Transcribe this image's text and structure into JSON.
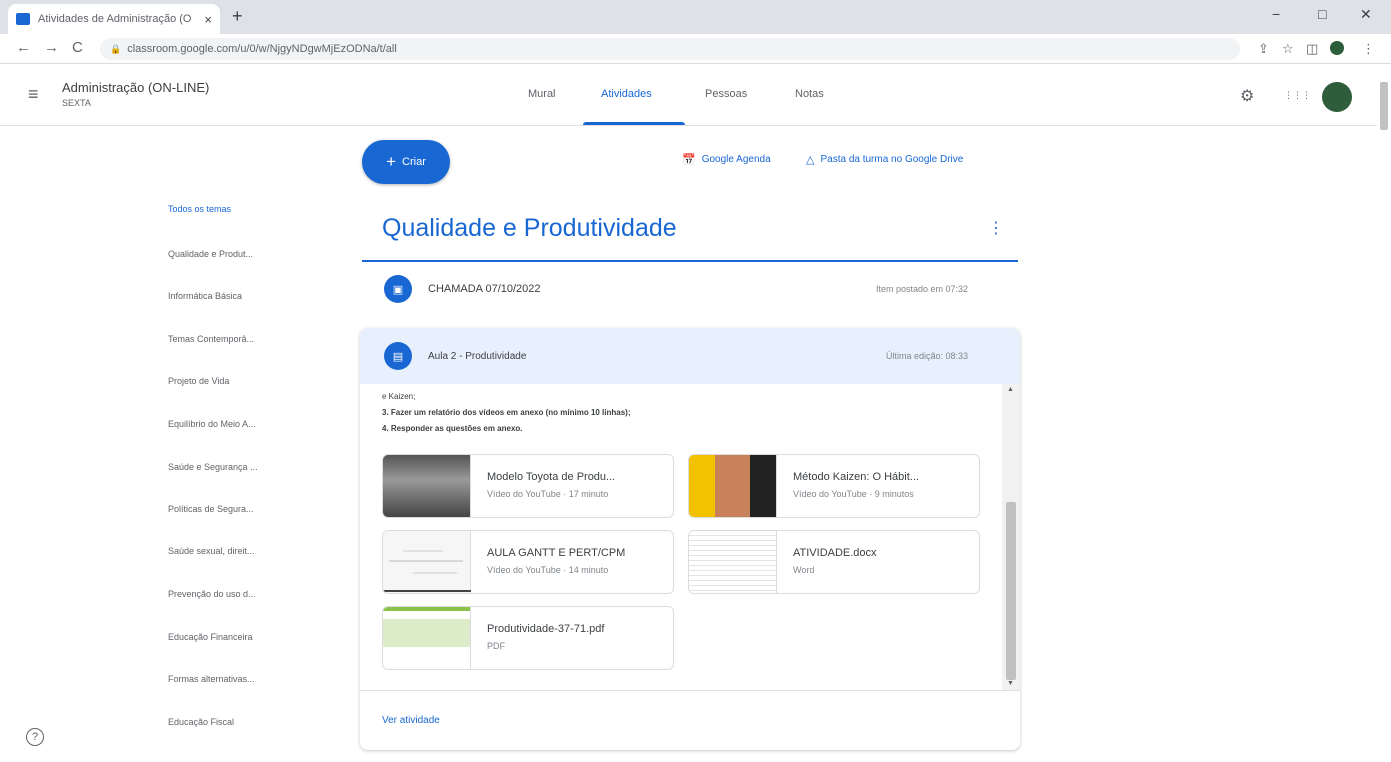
{
  "browser": {
    "tab_title": "Atividades de Administração (O",
    "tab_close": "×",
    "new_tab": "+",
    "url": "classroom.google.com/u/0/w/NjgyNDgwMjEzODNa/t/all",
    "back": "←",
    "forward": "→",
    "reload": "C",
    "lock": "🔒",
    "minimize": "−",
    "maximize": "□",
    "close": "✕",
    "share": "⇪",
    "star": "☆",
    "sidepanel": "◫",
    "more": "⋮"
  },
  "header": {
    "menu_icon": "≡",
    "class_name": "Administração (ON-LINE)",
    "class_section": "SEXTA",
    "tabs": [
      "Mural",
      "Atividades",
      "Pessoas",
      "Notas"
    ],
    "settings_icon": "⚙",
    "apps_icon": "⋮⋮⋮"
  },
  "sidebar": {
    "topics": [
      "Todos os temas",
      "Qualidade e Produt...",
      "Informática Básica",
      "Temas Contemporâ...",
      "Projeto de Vida",
      "Equilíbrio do Meio A...",
      "Saúde e Segurança ...",
      "Políticas de Segura...",
      "Saúde sexual, direit...",
      "Prevenção do uso d...",
      "Educação Financeira",
      "Formas alternativas...",
      "Educação Fiscal"
    ]
  },
  "main": {
    "create_label": "Criar",
    "create_icon": "+",
    "calendar_link": "Google Agenda",
    "calendar_icon": "📅",
    "drive_link": "Pasta da turma no Google Drive",
    "drive_icon": "△",
    "section_title": "Qualidade e Produtividade",
    "section_menu": "⋮",
    "assignment1": {
      "title": "CHAMADA 07/10/2022",
      "meta": "Item postado em 07:32",
      "icon": "▣"
    },
    "assignment2": {
      "title": "Aula 2 - Produtividade",
      "meta": "Última edição: 08:33",
      "icon": "▤",
      "desc_lines": [
        "e Kaizen;",
        "3. Fazer um relatório dos vídeos em anexo (no mínimo 10 linhas);",
        "4. Responder as questões em anexo."
      ],
      "attachments": [
        {
          "title": "Modelo Toyota de Produ...",
          "sub": "Vídeo do YouTube · 17 minuto"
        },
        {
          "title": "Método Kaizen: O Hábit...",
          "sub": "Vídeo do YouTube · 9 minutos"
        },
        {
          "title": "AULA GANTT E PERT/CPM",
          "sub": "Vídeo do YouTube · 14 minuto"
        },
        {
          "title": "ATIVIDADE.docx",
          "sub": "Word"
        },
        {
          "title": "Produtividade-37-71.pdf",
          "sub": "PDF"
        }
      ],
      "view_link": "Ver atividade"
    }
  },
  "help_icon": "?",
  "colors": {
    "accent": "#1967d2",
    "header_bg": "#e8f0fe",
    "text": "#3c4043"
  }
}
